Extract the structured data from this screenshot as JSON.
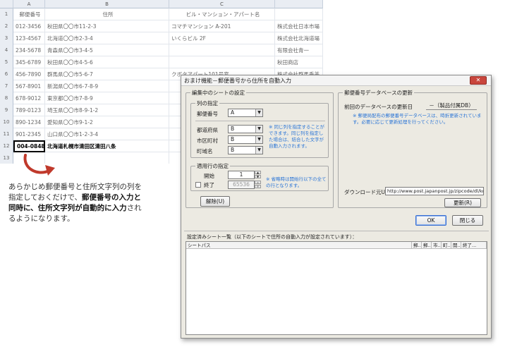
{
  "sheet": {
    "columns": [
      "A",
      "B",
      "C"
    ],
    "headers": [
      "郵便番号",
      "住所",
      "ビル・マンション・アパート名"
    ],
    "rows": [
      {
        "num": "1",
        "cells": [
          "",
          "",
          "",
          ""
        ]
      },
      {
        "num": "2",
        "cells": [
          "012-3456",
          "秋田県〇〇市11-2-3",
          "コマチマンション A-201",
          "株式会社日本市場"
        ]
      },
      {
        "num": "3",
        "cells": [
          "123-4567",
          "北海道〇〇市2-3-4",
          "いくらビル 2F",
          "株式会社北海道場"
        ]
      },
      {
        "num": "4",
        "cells": [
          "234-5678",
          "青森県〇〇市3-4-5",
          "",
          "有限会社青一"
        ]
      },
      {
        "num": "5",
        "cells": [
          "345-6789",
          "秋田県〇〇市4-5-6",
          "",
          "秋田商店"
        ]
      },
      {
        "num": "6",
        "cells": [
          "456-7890",
          "群馬県〇〇市5-6-7",
          "クボタアパート101号室",
          "株式会社群馬垂美"
        ]
      },
      {
        "num": "7",
        "cells": [
          "567-8901",
          "新潟県〇〇市6-7-8-9",
          "",
          ""
        ]
      },
      {
        "num": "8",
        "cells": [
          "678-9012",
          "東京都〇〇市7-8-9",
          "",
          ""
        ]
      },
      {
        "num": "9",
        "cells": [
          "789-0123",
          "埼玉県〇〇市8-9-1-2",
          "",
          ""
        ]
      },
      {
        "num": "10",
        "cells": [
          "890-1234",
          "愛知県〇〇市9-1-2",
          "",
          ""
        ]
      },
      {
        "num": "11",
        "cells": [
          "901-2345",
          "山口県〇〇市1-2-3-4",
          "",
          ""
        ]
      },
      {
        "num": "12",
        "cells": [
          "004-0848",
          "北海道札幌市清田区清田八条",
          "",
          ""
        ]
      },
      {
        "num": "13",
        "cells": [
          "",
          "",
          "",
          ""
        ]
      }
    ]
  },
  "caption": {
    "line1": "あらかじめ郵便番号と住所文字列の列を",
    "line2a": "指定しておくだけで、",
    "line2b": "郵便番号の入力と",
    "line3a": "同時に、住所文字列が自動的に入力",
    "line3b": "され",
    "line4": "るようになります。"
  },
  "dialog": {
    "title": "おまけ機能－郵便番号から住所を自動入力",
    "close_label": "✕",
    "sheet_settings": {
      "group_label": "編集中のシートの設定",
      "column_group_label": "列の指定",
      "postal_label": "郵便番号",
      "postal_value": "A",
      "pref_label": "都道府県",
      "pref_value": "B",
      "city_label": "市区町村",
      "city_value": "B",
      "town_label": "町域名",
      "town_value": "B",
      "column_note": "※ 同じ列を指定することができます。同じ列を指定した場合は、結合した文字が自動入力されます。",
      "row_group_label": "適用行の指定",
      "start_label": "開始",
      "start_value": "1",
      "end_label": "終了",
      "end_value": "65536",
      "row_note": "※ 省略時は開始行以下の全ての行となります。",
      "release_button": "解除(U)"
    },
    "db": {
      "group_label": "郵便番号データベースの更新",
      "last_update_label": "前回のデータベースの更新日",
      "last_update_value": "－（製品付属DB）",
      "db_note": "※ 郵便局配布の郵便番号データベースは、時折更新されています。必要に応じて更新処理を行ってください。",
      "download_label": "ダウンロード元URL",
      "download_url": "http://www.post.japanpost.jp/zipcode/dl/kogaki",
      "update_button": "更新(R)"
    },
    "ok_button": "OK",
    "close_button": "閉じる",
    "list": {
      "caption": "設定済みシート一覧（以下のシートで住所の自動入力が設定されています）：",
      "columns": [
        "シートパス",
        "郵...",
        "郵...",
        "市...",
        "町...",
        "開...",
        "終了..."
      ]
    }
  }
}
